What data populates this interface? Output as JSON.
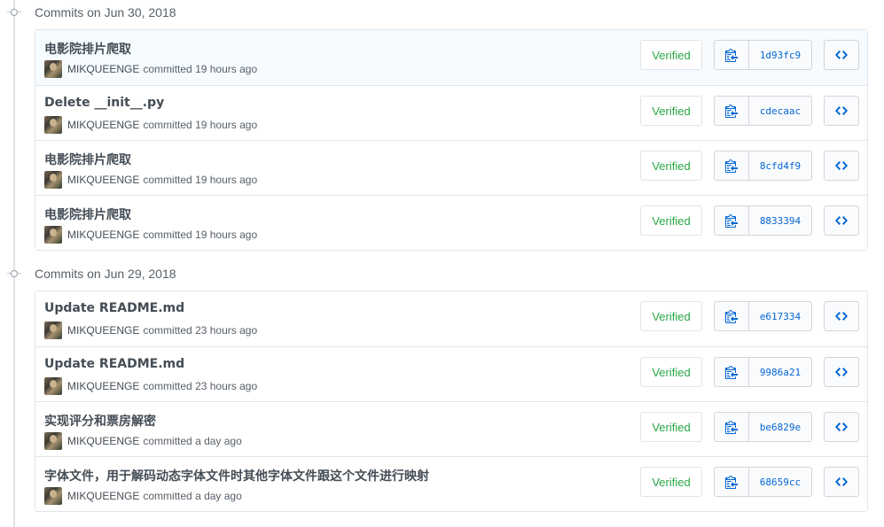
{
  "colors": {
    "accent": "#0366d6",
    "verified": "#28a745",
    "border": "#e1e4e8"
  },
  "groups": [
    {
      "label": "Commits on Jun 30, 2018",
      "commits": [
        {
          "title": "电影院排片爬取",
          "author": "MIKQUEENGE",
          "action": "committed",
          "time": "19 hours ago",
          "verified": "Verified",
          "sha": "1d93fc9"
        },
        {
          "title": "Delete __init__.py",
          "author": "MIKQUEENGE",
          "action": "committed",
          "time": "19 hours ago",
          "verified": "Verified",
          "sha": "cdecaac"
        },
        {
          "title": "电影院排片爬取",
          "author": "MIKQUEENGE",
          "action": "committed",
          "time": "19 hours ago",
          "verified": "Verified",
          "sha": "8cfd4f9"
        },
        {
          "title": "电影院排片爬取",
          "author": "MIKQUEENGE",
          "action": "committed",
          "time": "19 hours ago",
          "verified": "Verified",
          "sha": "8833394"
        }
      ]
    },
    {
      "label": "Commits on Jun 29, 2018",
      "commits": [
        {
          "title": "Update README.md",
          "author": "MIKQUEENGE",
          "action": "committed",
          "time": "23 hours ago",
          "verified": "Verified",
          "sha": "e617334"
        },
        {
          "title": "Update README.md",
          "author": "MIKQUEENGE",
          "action": "committed",
          "time": "23 hours ago",
          "verified": "Verified",
          "sha": "9986a21"
        },
        {
          "title": "实现评分和票房解密",
          "author": "MIKQUEENGE",
          "action": "committed",
          "time": "a day ago",
          "verified": "Verified",
          "sha": "be6829e"
        },
        {
          "title": "字体文件，用于解码动态字体文件时其他字体文件跟这个文件进行映射",
          "author": "MIKQUEENGE",
          "action": "committed",
          "time": "a day ago",
          "verified": "Verified",
          "sha": "68659cc"
        }
      ]
    }
  ],
  "icons": {
    "copy": "clipboard-icon",
    "browse": "code-icon",
    "group": "commit-node-icon"
  }
}
